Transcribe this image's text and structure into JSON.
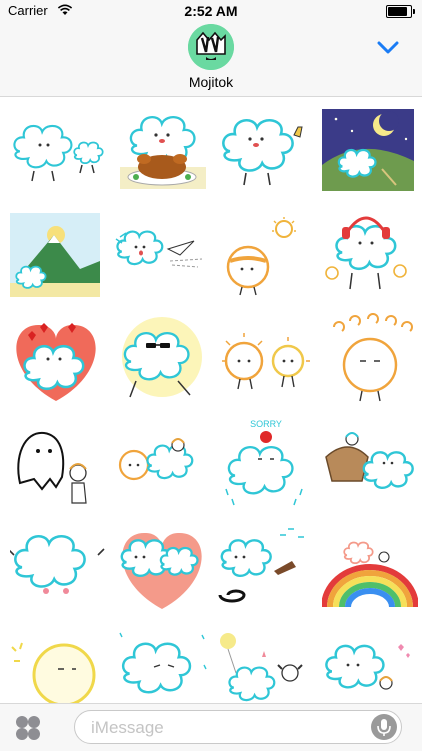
{
  "status_bar": {
    "carrier": "Carrier",
    "time": "2:52 AM"
  },
  "header": {
    "app_name": "Mojitok"
  },
  "stickers": {
    "sorry_text": "SORRY",
    "items": [
      {
        "name": "cloud-holding-small-cloud"
      },
      {
        "name": "cloud-with-roast-turkey"
      },
      {
        "name": "cloud-pointing-up"
      },
      {
        "name": "cloud-night-moon"
      },
      {
        "name": "cloud-mountain-sunrise"
      },
      {
        "name": "cloud-throwing-paper-plane"
      },
      {
        "name": "sun-ball-headband"
      },
      {
        "name": "cloud-with-headphones"
      },
      {
        "name": "cloud-red-hearts"
      },
      {
        "name": "cloud-sunglasses"
      },
      {
        "name": "two-suns"
      },
      {
        "name": "curly-hair-ball"
      },
      {
        "name": "ghost-and-child"
      },
      {
        "name": "sun-cloud-friends"
      },
      {
        "name": "cloud-sorry-apple"
      },
      {
        "name": "cloud-with-bowl"
      },
      {
        "name": "cloud-arms-open"
      },
      {
        "name": "cloud-heart-bandage"
      },
      {
        "name": "cloud-hair-dryer"
      },
      {
        "name": "cloud-rainbow"
      },
      {
        "name": "yellow-moon-ball"
      },
      {
        "name": "cloud-rain-sad"
      },
      {
        "name": "cloud-balloon-dog"
      },
      {
        "name": "cloud-pink-hearts"
      }
    ]
  },
  "input": {
    "placeholder": "iMessage",
    "value": ""
  },
  "colors": {
    "cloud_outline": "#2fc6d6",
    "sun_outline": "#f0b43c",
    "chevron": "#1a7cf5"
  }
}
